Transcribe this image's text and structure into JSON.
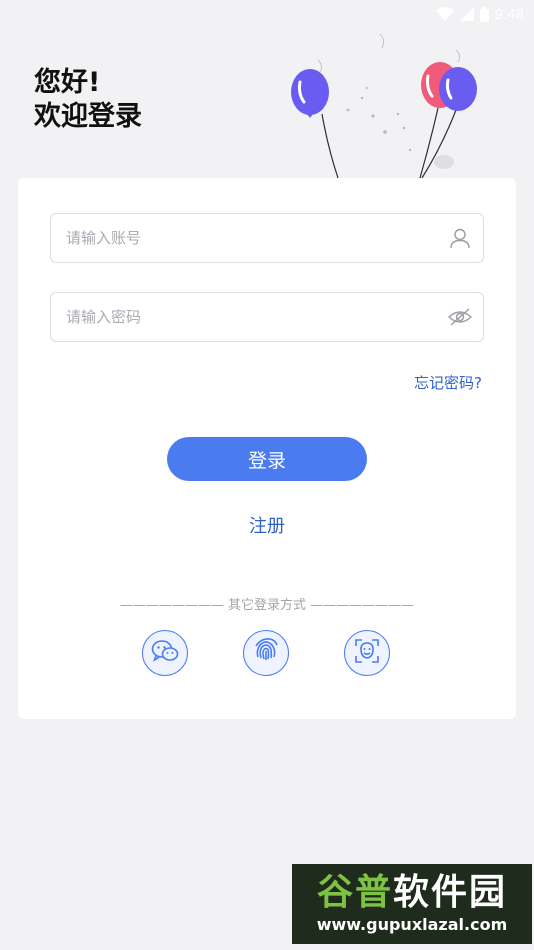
{
  "status_bar": {
    "time": "9:48",
    "icons": [
      "wifi-icon",
      "cell-signal-icon",
      "battery-icon"
    ],
    "color": "#ffffff"
  },
  "header": {
    "greeting_line1": "您好!",
    "greeting_line2": "欢迎登录",
    "decoration": "balloons"
  },
  "form": {
    "account_placeholder": "请输入账号",
    "account_icon": "user-icon",
    "password_placeholder": "请输入密码",
    "password_icon": "eye-off-icon",
    "forgot_label": "忘记密码?",
    "login_label": "登录",
    "register_label": "注册"
  },
  "other_login": {
    "label": "———————— 其它登录方式 ————————",
    "methods": [
      "wechat-icon",
      "fingerprint-icon",
      "face-scan-icon"
    ]
  },
  "watermark": {
    "title_part1": "谷普",
    "title_part2": "软件园",
    "url": "www.gupuxlazal.com"
  },
  "colors": {
    "accent": "#4a7cf0",
    "link": "#2f62c9",
    "background": "#f2f2f4",
    "card": "#ffffff"
  }
}
